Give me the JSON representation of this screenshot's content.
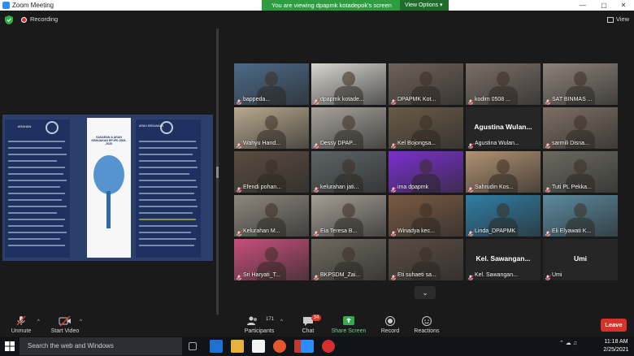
{
  "window": {
    "title": "Zoom Meeting",
    "minimize": "—",
    "maximize": "▢",
    "close": "✕"
  },
  "banner": {
    "text": "You are viewing dpapmk kotadepok's screen",
    "view_options": "View Options ▾"
  },
  "status": {
    "recording_label": "Recording",
    "view_label": "View"
  },
  "slide": {
    "left_header": "ARAHAN",
    "right_header": "ARAH KEBIJAKAN",
    "center_title": "SASARAN & ARAH KEBIJAKAN RPJPD 2006-2025"
  },
  "gallery": {
    "tiles": [
      {
        "name": "bappeda...",
        "type": "video",
        "bg": "#4c6a8a"
      },
      {
        "name": "dpapmk kotade...",
        "type": "video",
        "bg": "#d8d6cf",
        "active": true
      },
      {
        "name": "DPAPMK Kot...",
        "type": "video",
        "bg": "#6e6257"
      },
      {
        "name": "kodim 0508 ...",
        "type": "video",
        "bg": "#7a6f66"
      },
      {
        "name": "SAT BINMAS ...",
        "type": "video",
        "bg": "#8d8379"
      },
      {
        "name": "Wahyu Hand...",
        "type": "video",
        "bg": "#b9a98f"
      },
      {
        "name": "Dessy DPAP...",
        "type": "video",
        "bg": "#a8a39b"
      },
      {
        "name": "Kel Bojongsa...",
        "type": "video",
        "bg": "#6a5a46"
      },
      {
        "name": "Agustina Wulan...",
        "type": "name"
      },
      {
        "name": "sarmili Disna...",
        "type": "video",
        "bg": "#7c6f62"
      },
      {
        "name": "Efendi pohan...",
        "type": "video",
        "bg": "#5a4c3f"
      },
      {
        "name": "kelurahan jati...",
        "type": "video",
        "bg": "#5d6466"
      },
      {
        "name": "ima dpapmk",
        "type": "video",
        "bg": "#7b2fd0"
      },
      {
        "name": "Sahrudin Kos...",
        "type": "video",
        "bg": "#b09272"
      },
      {
        "name": "Tuti PL Pekka...",
        "type": "video",
        "bg": "#6b6a60"
      },
      {
        "name": "Kelurahan M...",
        "type": "video",
        "bg": "#8e877d"
      },
      {
        "name": "Eia Teresa B...",
        "type": "video",
        "bg": "#a59e94"
      },
      {
        "name": "Winadya kec...",
        "type": "video",
        "bg": "#7a5a43"
      },
      {
        "name": "Linda_DPAPMK",
        "type": "video",
        "bg": "#2f7fa6"
      },
      {
        "name": "Eli Elyawati K...",
        "type": "video",
        "bg": "#5b8ba0"
      },
      {
        "name": "Sri Haryati_T...",
        "type": "video",
        "bg": "#c84f7b"
      },
      {
        "name": "BKPSDM_Zai...",
        "type": "video",
        "bg": "#6f6a5f"
      },
      {
        "name": "Eti suhaeti sa...",
        "type": "video",
        "bg": "#5b4c42"
      },
      {
        "name": "Kel. Sawangan...",
        "type": "name"
      },
      {
        "name": "Umi",
        "type": "name"
      }
    ]
  },
  "toolbar": {
    "unmute": "Unmute",
    "start_video": "Start Video",
    "participants": "Participants",
    "participants_count": "171",
    "chat": "Chat",
    "chat_badge": "34",
    "share_screen": "Share Screen",
    "record": "Record",
    "reactions": "Reactions",
    "leave": "Leave"
  },
  "taskbar": {
    "search_placeholder": "Search the web and Windows",
    "time": "11:18 AM",
    "date": "2/25/2021"
  },
  "colors": {
    "accent": "#2d8cff",
    "banner_green": "#2e9d3f",
    "leave_red": "#d9322b",
    "active_speaker": "#f3e04a"
  }
}
